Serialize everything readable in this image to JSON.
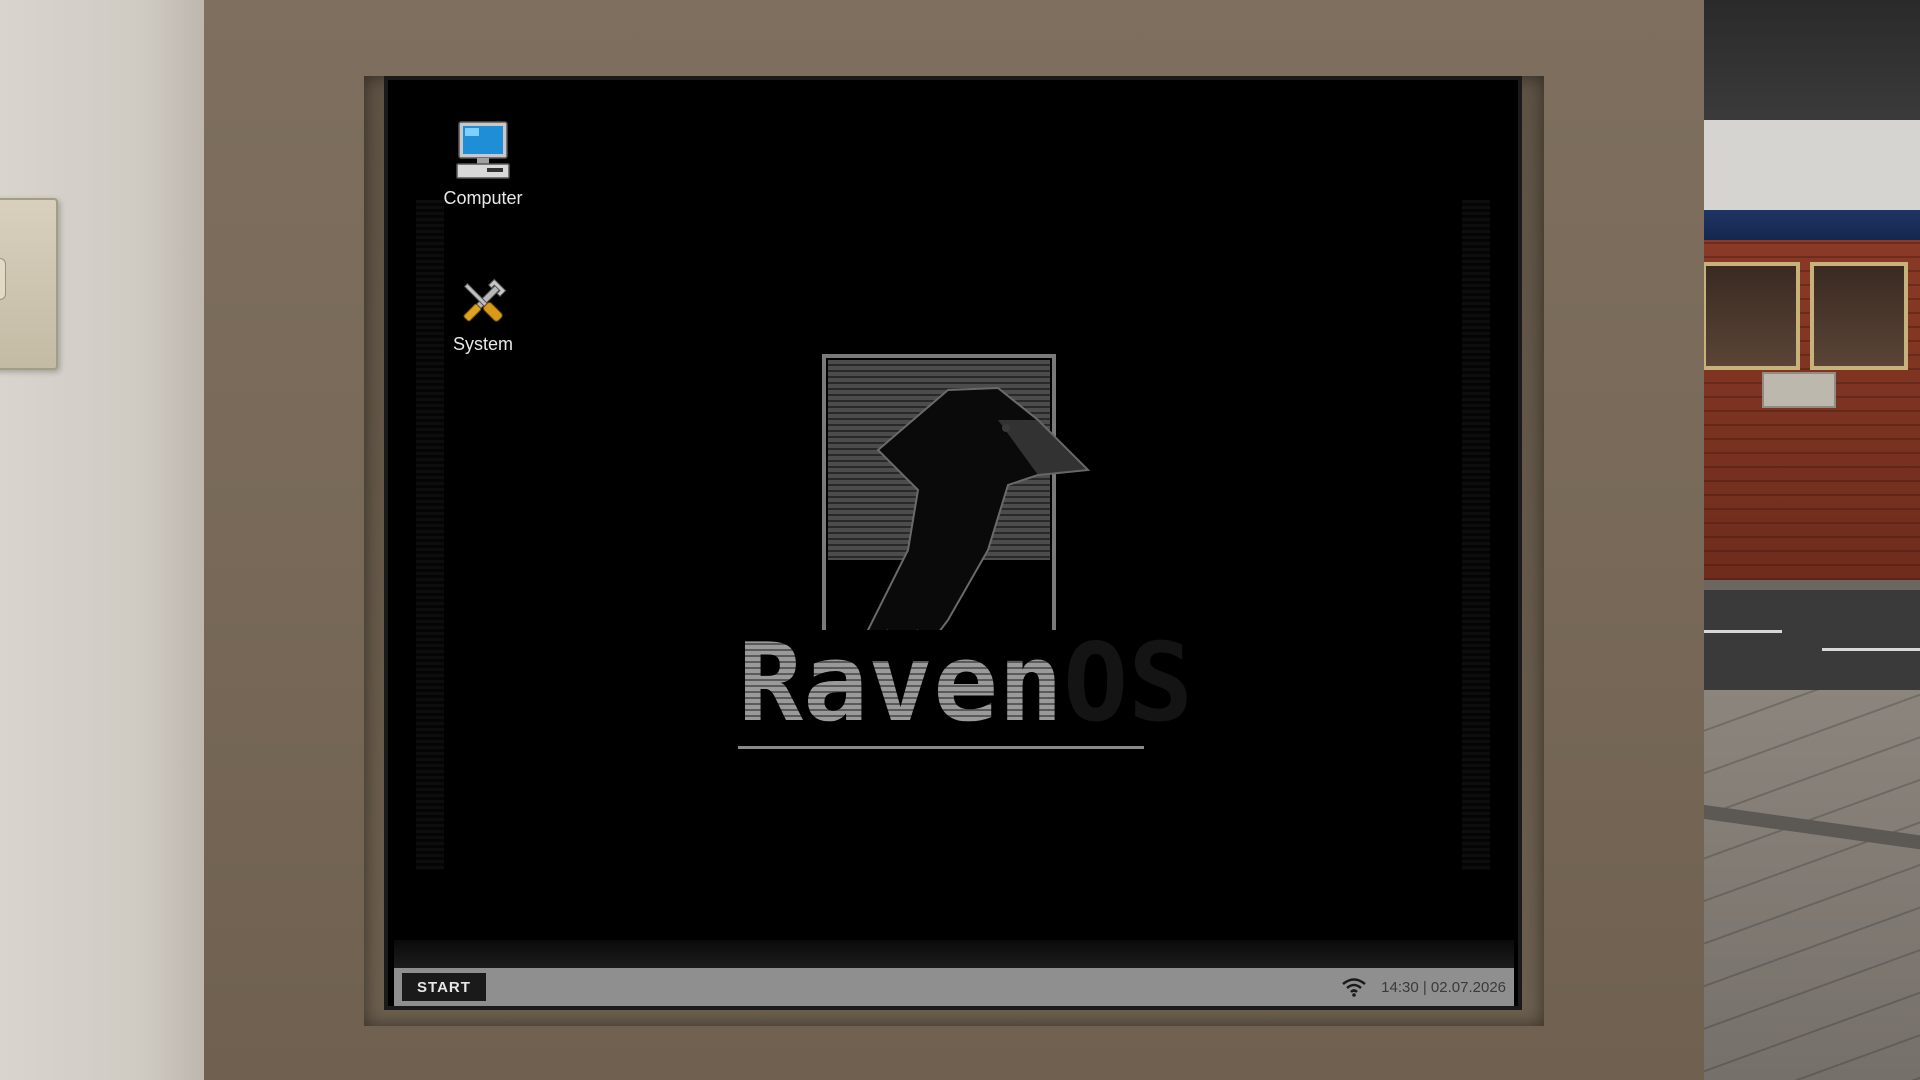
{
  "desktop": {
    "icons": [
      {
        "label": "Computer",
        "icon": "computer-icon"
      },
      {
        "label": "System",
        "icon": "tools-icon"
      }
    ],
    "logo": {
      "word_primary": "Raven",
      "word_secondary": "OS",
      "icon": "raven-logo"
    }
  },
  "taskbar": {
    "start_label": "START",
    "wifi_icon": "wifi-icon",
    "clock": "14:30 | 02.07.2026"
  },
  "colors": {
    "bezel": "#786958",
    "screen": "#000000",
    "taskbar": "#8f8f8f",
    "start_button": "#1a1a1a"
  }
}
